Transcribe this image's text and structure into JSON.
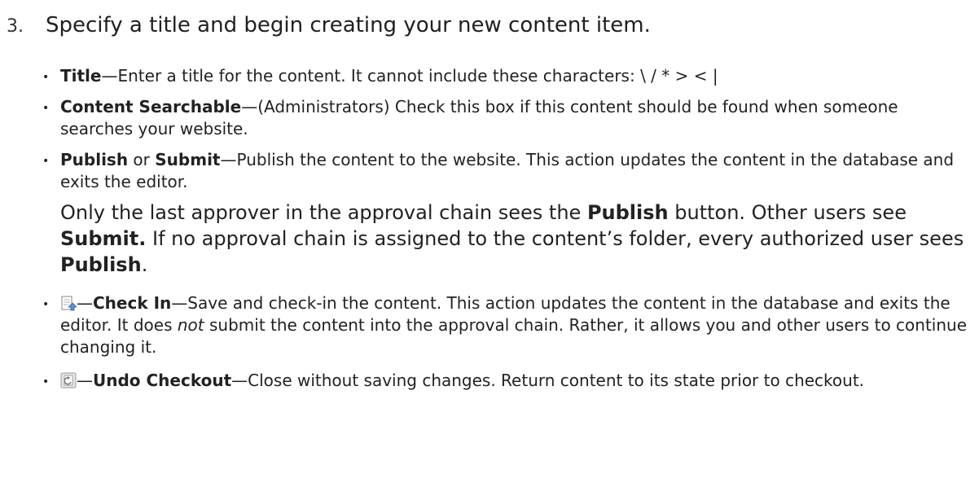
{
  "step": {
    "number": "3.",
    "text": "Specify a title and begin creating your new content item."
  },
  "bullets": {
    "title": {
      "term": "Title",
      "desc": "—Enter a title for the content. It cannot include these characters: \\ / * > < |"
    },
    "searchable": {
      "term": "Content Searchable",
      "desc": "—(Administrators) Check this box if this content should be found when someone searches your website."
    },
    "publish": {
      "term1": "Publish",
      "or": " or ",
      "term2": "Submit",
      "desc": "—Publish the content to the website. This action updates the content in the database and exits the editor."
    },
    "note": {
      "t1": "Only the last approver in the approval chain sees the ",
      "b1": "Publish",
      "t2": " button. Other users see ",
      "b2": "Submit.",
      "t3": " If no approval chain is assigned to the content’s folder, every authorized user sees ",
      "b3": "Publish",
      "t4": "."
    },
    "checkin": {
      "icon": "check-in-icon",
      "dash": "—",
      "term": "Check In",
      "desc1": "—Save and check-in the content. This action updates the content in the database and exits the editor. It does ",
      "emph": "not",
      "desc2": " submit the content into the approval chain. Rather, it allows you and other users to continue changing it."
    },
    "undo": {
      "icon": "undo-checkout-icon",
      "dash": "—",
      "term": "Undo Checkout",
      "desc": "—Close without saving changes. Return content to its state prior to checkout."
    }
  }
}
